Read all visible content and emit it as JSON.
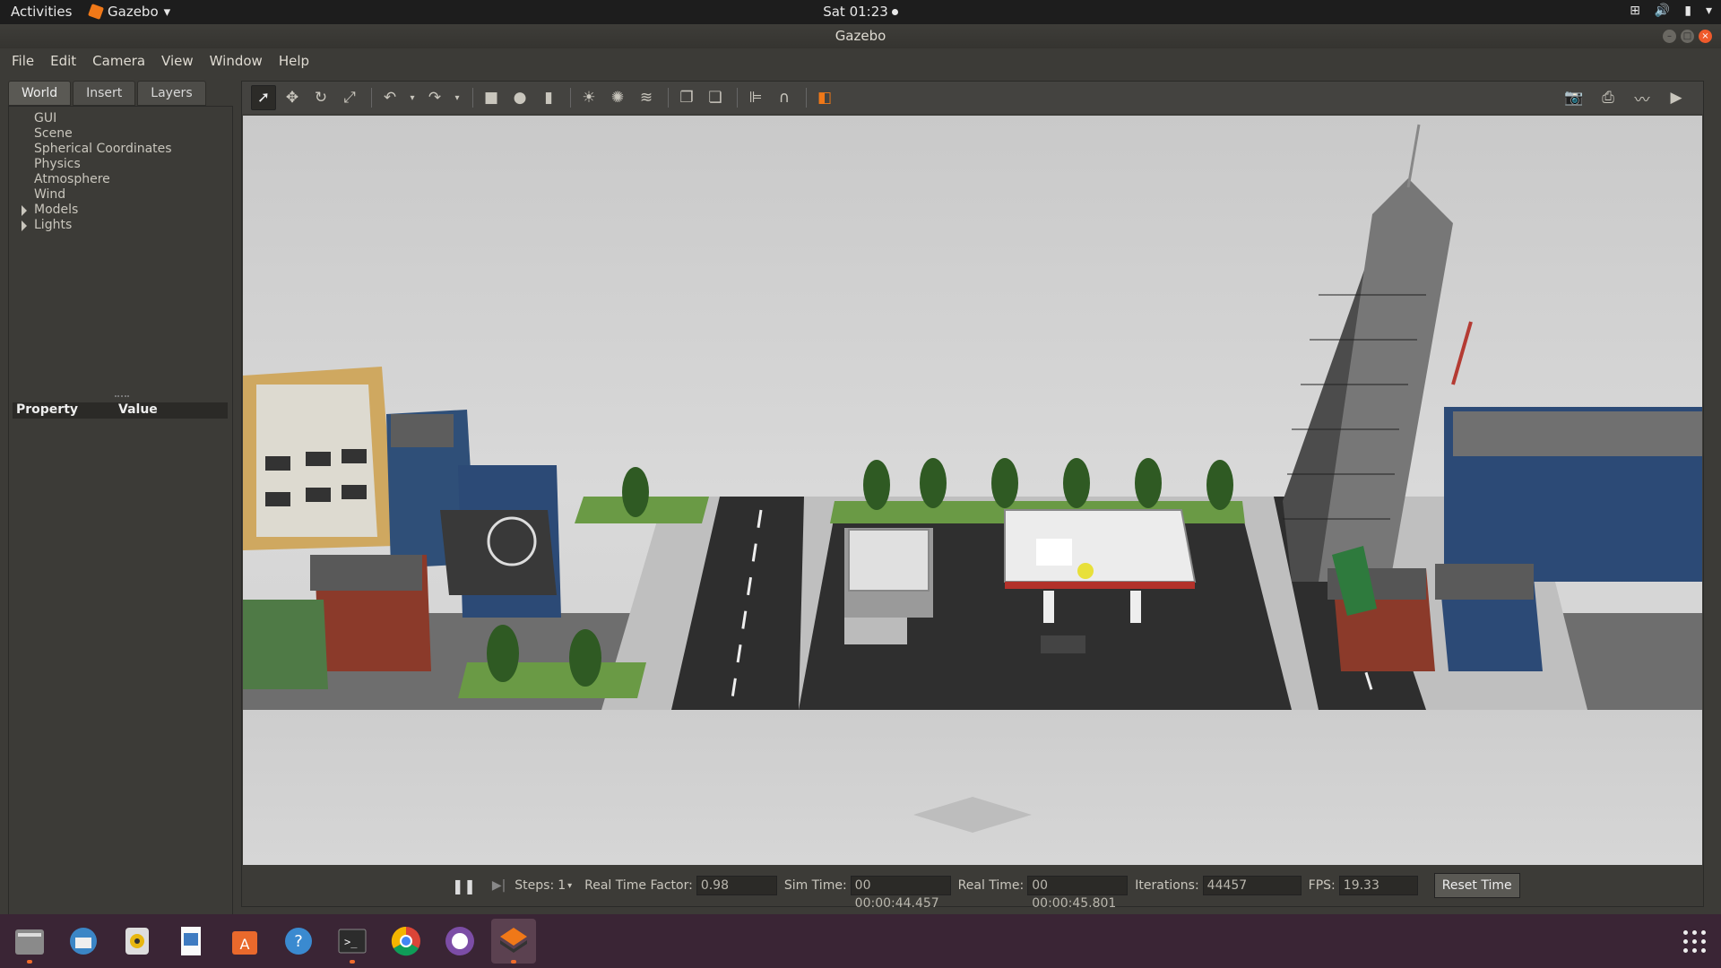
{
  "topbar": {
    "activities": "Activities",
    "app_name": "Gazebo",
    "clock": "Sat 01:23"
  },
  "window": {
    "title": "Gazebo"
  },
  "menu": [
    "File",
    "Edit",
    "Camera",
    "View",
    "Window",
    "Help"
  ],
  "left_panel": {
    "tabs": [
      "World",
      "Insert",
      "Layers"
    ],
    "active_tab": "World",
    "tree": [
      {
        "label": "GUI",
        "expandable": false
      },
      {
        "label": "Scene",
        "expandable": false
      },
      {
        "label": "Spherical Coordinates",
        "expandable": false
      },
      {
        "label": "Physics",
        "expandable": false
      },
      {
        "label": "Atmosphere",
        "expandable": false
      },
      {
        "label": "Wind",
        "expandable": false
      },
      {
        "label": "Models",
        "expandable": true
      },
      {
        "label": "Lights",
        "expandable": true
      }
    ],
    "property_header": {
      "property": "Property",
      "value": "Value"
    }
  },
  "toolbar": {
    "tools": [
      "select-mode-icon",
      "translate-mode-icon",
      "rotate-mode-icon",
      "scale-mode-icon",
      "undo-icon",
      "redo-icon",
      "box-shape-icon",
      "sphere-shape-icon",
      "cylinder-shape-icon",
      "point-light-icon",
      "spot-light-icon",
      "directional-light-icon",
      "copy-icon",
      "paste-icon",
      "align-icon",
      "snap-icon",
      "view-angle-icon"
    ],
    "right_tools": [
      "screenshot-icon",
      "log-icon",
      "plot-icon",
      "video-record-icon"
    ]
  },
  "bottom_bar": {
    "steps_label": "Steps:",
    "steps_value": "1",
    "rtf_label": "Real Time Factor:",
    "rtf_value": "0.98",
    "sim_time_label": "Sim Time:",
    "sim_time_value": "00 00:00:44.457",
    "real_time_label": "Real Time:",
    "real_time_value": "00 00:00:45.801",
    "iterations_label": "Iterations:",
    "iterations_value": "44457",
    "fps_label": "FPS:",
    "fps_value": "19.33",
    "reset_label": "Reset Time"
  },
  "dock": [
    "files-icon",
    "thunderbird-icon",
    "rhythmbox-icon",
    "libreoffice-writer-icon",
    "software-center-icon",
    "help-icon",
    "terminal-icon",
    "chrome-icon",
    "github-desktop-icon",
    "gazebo-icon"
  ]
}
